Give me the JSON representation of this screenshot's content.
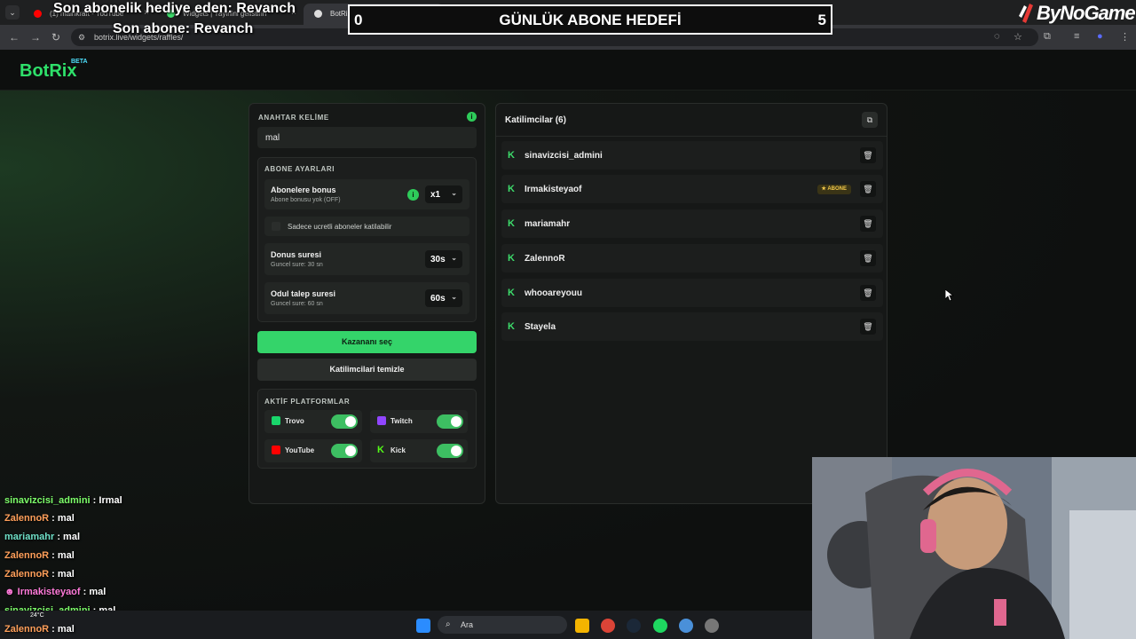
{
  "browser": {
    "tabs": [
      {
        "label": "(1) mainkraft - YouTube"
      },
      {
        "label": "Widgets | Yayinini gelistirin"
      },
      {
        "label": "BotRix | Cekilisler"
      }
    ],
    "url": "botrix.live/widgets/raffles/"
  },
  "overlays": {
    "last_gift_sub": "Son abonelik hediye eden: Revanch",
    "last_sub": "Son abone: Revanch",
    "goal": {
      "title": "GÜNLÜK ABONE HEDEFİ",
      "current": "0",
      "target": "5"
    },
    "brand": "ByNoGame"
  },
  "app": {
    "logo": "BotRix",
    "logo_badge": "BETA"
  },
  "left_panel": {
    "keyword_label": "ANAHTAR KELİME",
    "keyword_value": "mal",
    "sub_settings_label": "ABONE AYARLARI",
    "sub_bonus": {
      "title": "Abonelere bonus",
      "subtitle": "Abone bonusu yok (OFF)",
      "value": "x1"
    },
    "paid_only_label": "Sadece ucretli aboneler katilabilir",
    "bonus_duration": {
      "title": "Donus suresi",
      "subtitle": "Guncel sure: 30 sn",
      "value": "30s"
    },
    "claim_duration": {
      "title": "Odul talep suresi",
      "subtitle": "Guncel sure: 60 sn",
      "value": "60s"
    },
    "pick_winner": "Kazananı seç",
    "clear_participants": "Katilimcilari temizle",
    "platforms_label": "AKTİF PLATFORMLAR",
    "platforms": [
      {
        "name": "Trovo",
        "enabled": true,
        "color": "#19d66b"
      },
      {
        "name": "Twitch",
        "enabled": true,
        "color": "#9146ff"
      },
      {
        "name": "YouTube",
        "enabled": true,
        "color": "#ff0000"
      },
      {
        "name": "Kick",
        "enabled": true,
        "color": "#53fc18"
      }
    ]
  },
  "right_panel": {
    "title": "Katilimcilar (6)",
    "participants": [
      {
        "name": "sinavizcisi_admini",
        "badge": ""
      },
      {
        "name": "Irmakisteyaof",
        "badge": "★ ABONE"
      },
      {
        "name": "mariamahr",
        "badge": ""
      },
      {
        "name": "ZalennoR",
        "badge": ""
      },
      {
        "name": "whooareyouu",
        "badge": ""
      },
      {
        "name": "Stayela",
        "badge": ""
      }
    ]
  },
  "chat": [
    {
      "user": "sinavizcisi_admini",
      "msg": " : Irmal",
      "color": "#7dff6a"
    },
    {
      "user": "ZalennoR",
      "msg": " : mal",
      "color": "#ff9f5a"
    },
    {
      "user": "mariamahr",
      "msg": " : mal",
      "color": "#6fe0c8"
    },
    {
      "user": "ZalennoR",
      "msg": " : mal",
      "color": "#ff9f5a"
    },
    {
      "user": "ZalennoR",
      "msg": " : mal",
      "color": "#ff9f5a"
    },
    {
      "user": "Irmakisteyaof",
      "msg": " : mal",
      "color": "#ff7ad9"
    },
    {
      "user": "sinavizcisi_admini",
      "msg": " : mal",
      "color": "#7dff6a"
    },
    {
      "user": "ZalennoR",
      "msg": " : mal",
      "color": "#ff9f5a"
    }
  ],
  "taskbar": {
    "search_placeholder": "Ara",
    "temperature": "24°C"
  }
}
